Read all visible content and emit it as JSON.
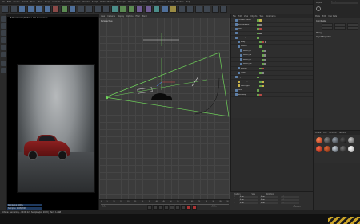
{
  "app": {
    "menus": [
      "File",
      "Edit",
      "Create",
      "Select",
      "Tools",
      "Mesh",
      "Snap",
      "Animate",
      "Simulate",
      "Tracker",
      "Render",
      "Sculpt",
      "Motion Tracker",
      "MoGraph",
      "Character",
      "Pipeline",
      "Plugins",
      "Octane",
      "Script",
      "Window",
      "Help"
    ],
    "layout_label": "Layout:",
    "layout_value": "Standard"
  },
  "picture_viewer": {
    "title": "PictureViewer/Octane LV Live Viewer",
    "info_lines": [
      "Rendering: 100%",
      "Samples: 2048/2048",
      "Time: 00:01:23"
    ]
  },
  "viewport": {
    "menus": [
      "View",
      "Cameras",
      "Display",
      "Options",
      "Filter",
      "Panel"
    ],
    "label": "Perspective"
  },
  "object_manager": {
    "menus": [
      "File",
      "Edit",
      "View",
      "Objects",
      "Tags",
      "Bookmarks"
    ],
    "objects": [
      {
        "name": "OctaneCamera"
      },
      {
        "name": "Environment"
      },
      {
        "name": "Sky"
      },
      {
        "name": "Floor"
      },
      {
        "name": "Porsche_911"
      },
      {
        "name": "Body"
      },
      {
        "name": "Wheels"
      },
      {
        "name": "Wheel_FL"
      },
      {
        "name": "Wheel_FR"
      },
      {
        "name": "Wheel_RL"
      },
      {
        "name": "Wheel_RR"
      },
      {
        "name": "Interior"
      },
      {
        "name": "Glass"
      },
      {
        "name": "Lights"
      },
      {
        "name": "Area Light"
      },
      {
        "name": "Spot Light"
      },
      {
        "name": "Null"
      },
      {
        "name": "Backdrop"
      }
    ]
  },
  "attributes": {
    "tabs": [
      "Mode",
      "Edit",
      "User Data"
    ],
    "sections": [
      "Coordinates",
      "Phong",
      "Object Properties"
    ]
  },
  "materials": {
    "menus": [
      "Create",
      "Edit",
      "Function",
      "Texture"
    ]
  },
  "coordinates": {
    "headers": [
      "Position",
      "Size",
      "Rotation"
    ],
    "rows": [
      {
        "axis": "X",
        "pos": "0 cm",
        "size": "0 cm",
        "rot": "0 °"
      },
      {
        "axis": "Y",
        "pos": "0 cm",
        "size": "0 cm",
        "rot": "0 °"
      },
      {
        "axis": "Z",
        "pos": "0 cm",
        "size": "0 cm",
        "rot": "0 °"
      }
    ],
    "apply": "Apply"
  },
  "timeline": {
    "ticks": [
      "0",
      "5",
      "10",
      "15",
      "20",
      "25",
      "30",
      "35",
      "40",
      "45",
      "50",
      "55",
      "60",
      "65",
      "70",
      "75",
      "80",
      "85",
      "90"
    ],
    "frame_start": "0 F",
    "frame_end": "90 F"
  },
  "status": {
    "text": "Octane: Rendering... 00:00:12 | Samples/px: 2048 | Mem: 1.2GB"
  },
  "colors": {
    "accent": "#4f6f99",
    "frustum": "#6fd35a",
    "car": "#8b2020"
  }
}
